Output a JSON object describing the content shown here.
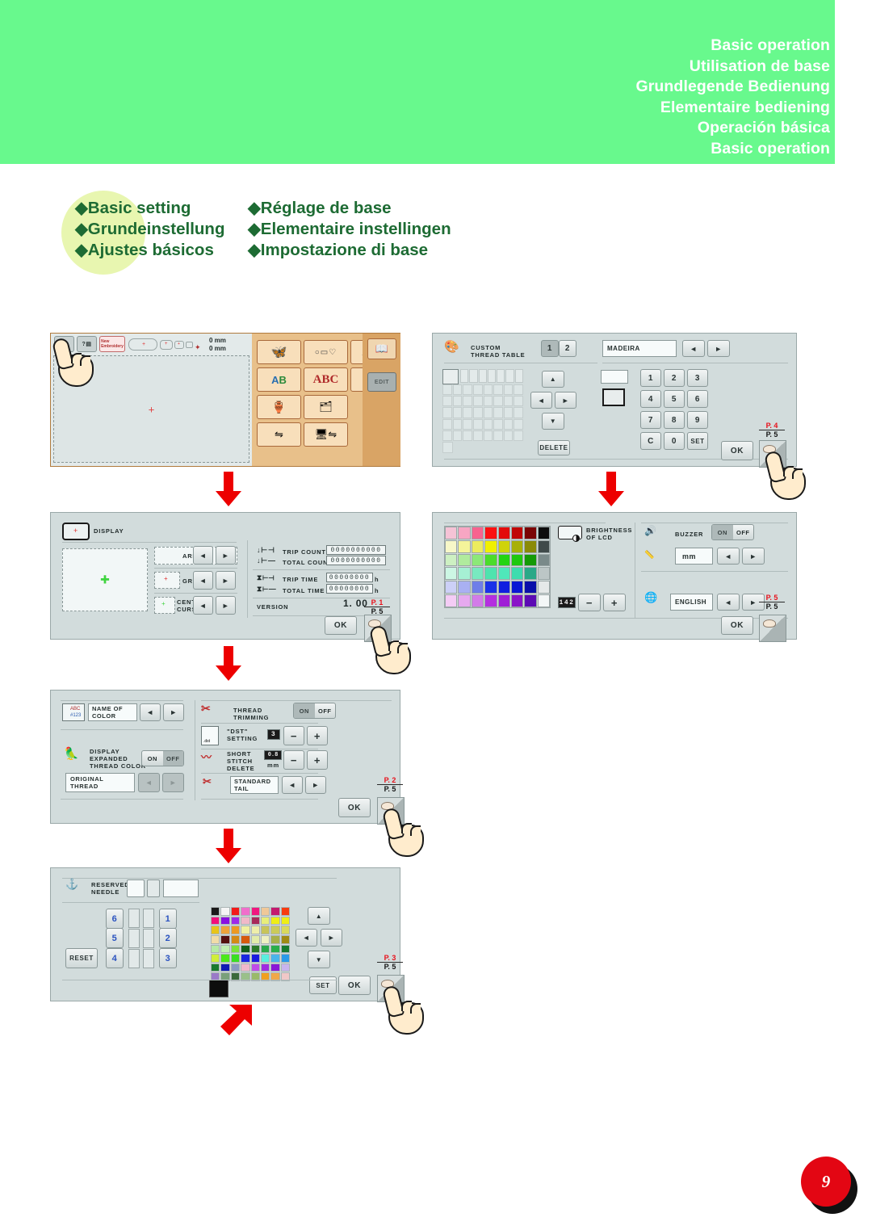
{
  "header": {
    "titles": [
      "Basic operation",
      "Utilisation de base",
      "Grundlegende Bedienung",
      "Elementaire bediening",
      "Operación básica",
      "Basic operation"
    ],
    "bg_color": "#68f98d"
  },
  "section_title": {
    "col1": [
      "◆Basic setting",
      "◆Grundeinstellung",
      "◆Ajustes básicos"
    ],
    "col2": [
      "◆Réglage de base",
      "◆Elementaire instellingen",
      "◆Impostazione di base"
    ],
    "text_color": "#1d6b33",
    "blob_color": "#e8f6b0"
  },
  "screen_home": {
    "name": "home-screen",
    "top_bar": {
      "new_embroidery_label": "New\nEmbroidery",
      "dim_x": "0 mm",
      "dim_y": "0 mm"
    },
    "menu_buttons": [
      "embroidery-patterns-icon",
      "frame-shapes-icon",
      "letters-icon",
      "alphabet-frame-icon",
      "abc-decorative-icon",
      "ab-gold-icon",
      "monogram-icon",
      "card-icon",
      "usb-icon",
      "pc-usb-icon"
    ],
    "side_buttons": [
      "guide-icon",
      "EDIT"
    ]
  },
  "screen_thread_table": {
    "name": "custom-thread-table-screen",
    "title": "CUSTOM\nTHREAD TABLE",
    "tab_1": "1",
    "tab_2": "2",
    "brand_field": "MADEIRA",
    "number_field": "",
    "keypad": [
      "1",
      "2",
      "3",
      "4",
      "5",
      "6",
      "7",
      "8",
      "9",
      "C",
      "0",
      "SET"
    ],
    "delete_label": "DELETE",
    "ok_label": "OK",
    "page_current": "P. 4",
    "page_total": "P. 5"
  },
  "screen_display": {
    "name": "display-settings-screen",
    "title": "DISPLAY",
    "rows": [
      {
        "label": "AREA"
      },
      {
        "label": "GRID"
      },
      {
        "label": "CENTER\nCURSOR"
      }
    ],
    "counters": [
      {
        "label": "TRIP COUNT",
        "value": "0000000000",
        "unit": ""
      },
      {
        "label": "TOTAL COUNT",
        "value": "0000000000",
        "unit": ""
      },
      {
        "label": "TRIP TIME",
        "value": "00000000",
        "unit": "h"
      },
      {
        "label": "TOTAL TIME",
        "value": "00000000",
        "unit": "h"
      }
    ],
    "version_label": "VERSION",
    "version_value": "1. 00",
    "ok_label": "OK",
    "page_current": "P. 1",
    "page_total": "P. 5"
  },
  "screen_brightness": {
    "name": "brightness-language-screen",
    "brightness_label": "BRIGHTNESS\nOF LCD",
    "brightness_value": "142",
    "minus_label": "−",
    "plus_label": "+",
    "buzzer_label": "BUZZER",
    "buzzer_on": "ON",
    "buzzer_off": "OFF",
    "buzzer_state": "ON",
    "unit_field": "mm",
    "language_field": "ENGLISH",
    "ok_label": "OK",
    "page_current": "P. 5",
    "page_total": "P. 5",
    "palette_rows": [
      [
        "#f5c3d6",
        "#f7a6c3",
        "#f7638f",
        "#fc1010",
        "#e30b0b",
        "#c00707",
        "#7a0505",
        "#0d0d0d"
      ],
      [
        "#f7f7c8",
        "#f4f49a",
        "#ecec5e",
        "#f0f000",
        "#cfd30a",
        "#a8b008",
        "#8a8a07",
        "#3f4a4a"
      ],
      [
        "#cdf0c2",
        "#b0eb9d",
        "#8ce878",
        "#4bdc2a",
        "#23d411",
        "#1fc80e",
        "#149a06",
        "#7a8a8a"
      ],
      [
        "#ccf6e4",
        "#a6f0d4",
        "#78e9c0",
        "#4ee3ae",
        "#4fe7ba",
        "#3ddcae",
        "#2aa887",
        "#bcc6c6"
      ],
      [
        "#ccd0f7",
        "#a9b0f2",
        "#6f7ee8",
        "#1a32e8",
        "#0f1fe0",
        "#0a18d4",
        "#0a10aa",
        "#e5e9e9"
      ],
      [
        "#f4ccf5",
        "#e6a9ef",
        "#d27be8",
        "#b42fe0",
        "#9f1fd6",
        "#8a14c8",
        "#5c0bb4",
        "#f3f7f7"
      ]
    ]
  },
  "screen_thread_trim": {
    "name": "thread-trimming-screen",
    "name_of_color_field": "NAME OF COLOR",
    "display_expanded_label": "DISPLAY\nEXPANDED\nTHREAD COLOR",
    "display_expanded_on": "ON",
    "display_expanded_off": "OFF",
    "display_expanded_state": "OFF",
    "original_thread_field": "ORIGINAL\nTHREAD",
    "thread_trimming_label": "THREAD\nTRIMMING",
    "thread_trimming_on": "ON",
    "thread_trimming_off": "OFF",
    "thread_trimming_state": "ON",
    "dst_setting_label": "\"DST\"\nSETTING",
    "dst_value": "3",
    "short_stitch_label": "SHORT\nSTITCH\nDELETE",
    "short_stitch_value": "0.8",
    "short_stitch_unit": "mm",
    "standard_tail_field": "STANDARD TAIL",
    "minus_label": "−",
    "plus_label": "+",
    "ok_label": "OK",
    "page_current": "P. 2",
    "page_total": "P. 5"
  },
  "screen_reserved_needle": {
    "name": "reserved-needle-screen",
    "title": "RESERVED\nNEEDLE",
    "reset_label": "RESET",
    "needles_left": [
      "6",
      "5",
      "4"
    ],
    "needles_right": [
      "1",
      "2",
      "3"
    ],
    "set_label": "SET",
    "ok_label": "OK",
    "page_current": "P. 3",
    "page_total": "P. 5",
    "palette_rows": [
      [
        "#1a1a1a",
        "#f5f5f5",
        "#f21b1b",
        "#f06ecb",
        "#f0177f",
        "#f0c898",
        "#c41a6e",
        "#f73b10"
      ],
      [
        "#f20f7a",
        "#8a0fe0",
        "#9f2ae8",
        "#f0b9c8",
        "#a82a5a",
        "#e8ee7a",
        "#eeee16",
        "#eeee16"
      ],
      [
        "#e8c41a",
        "#eda33a",
        "#ed9a22",
        "#f0f0a0",
        "#eeeeaa",
        "#c8c45a",
        "#cbcb5a",
        "#d9d95c"
      ],
      [
        "#f0dca8",
        "#551010",
        "#d48a16",
        "#d65a0c",
        "#e2ecaa",
        "#eef0c2",
        "#a8b04a",
        "#a08a14"
      ],
      [
        "#b6eaa6",
        "#c2eeb4",
        "#7ce23a",
        "#13601a",
        "#2c7a2a",
        "#2aa84a",
        "#2aae4a",
        "#177a2e"
      ],
      [
        "#d0ee3a",
        "#4ce81a",
        "#3ade22",
        "#1a26e0",
        "#1a1ae0",
        "#5aeede",
        "#4ab4ea",
        "#2a9ae8"
      ],
      [
        "#1a7a2e",
        "#0f1ab4",
        "#8a9ac0",
        "#f0b8cc",
        "#c04ae8",
        "#a02ae0",
        "#8a16d6",
        "#c8b4ee"
      ],
      [
        "#9a7ac8",
        "#7aa07a",
        "#3a6a3a",
        "#9ac08a",
        "#9aba6a",
        "#f0a020",
        "#f0a84a",
        "#f0c8c8"
      ]
    ],
    "swatch_selected": "#0d0d0d"
  },
  "page_number": "9"
}
